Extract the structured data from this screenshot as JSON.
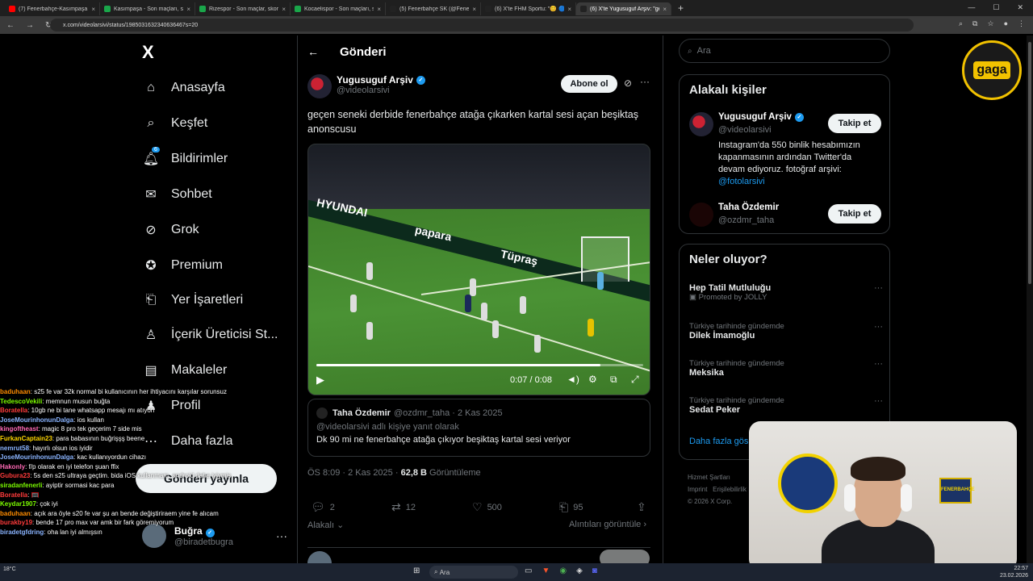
{
  "browser": {
    "tabs": [
      {
        "title": "(7) Fenerbahçe-Kasımpaşa Ma:",
        "color": "#ff0000"
      },
      {
        "title": "Kasımpaşa - Son maçları, skorla",
        "color": "#1aa64a"
      },
      {
        "title": "Rizespor - Son maçlar, skorlar",
        "color": "#1aa64a"
      },
      {
        "title": "Kocaelispor - Son maçları, skorl",
        "color": "#1aa64a"
      },
      {
        "title": "(5) Fenerbahçe SK (@Fenerbah",
        "color": "#222222"
      },
      {
        "title": "(6) X'te FHM Sportu: \"😊 🔵 Fe",
        "color": "#222222"
      },
      {
        "title": "(6) X'te Yugusuguf Arşiv: \"geçe",
        "color": "#222222"
      }
    ],
    "url": "x.com/videolarsivi/status/1985031632340636467s=20"
  },
  "nav": {
    "logo": "X",
    "items": [
      {
        "label": "Anasayfa",
        "icon": "home-icon"
      },
      {
        "label": "Keşfet",
        "icon": "search-icon"
      },
      {
        "label": "Bildirimler",
        "icon": "bell-icon",
        "badge": "6"
      },
      {
        "label": "Sohbet",
        "icon": "mail-icon"
      },
      {
        "label": "Grok",
        "icon": "grok-icon"
      },
      {
        "label": "Premium",
        "icon": "premium-icon"
      },
      {
        "label": "Yer İşaretleri",
        "icon": "bookmark-icon"
      },
      {
        "label": "İçerik Üreticisi St...",
        "icon": "creator-icon"
      },
      {
        "label": "Makaleler",
        "icon": "articles-icon"
      },
      {
        "label": "Profil",
        "icon": "profile-icon"
      },
      {
        "label": "Daha fazla",
        "icon": "more-icon"
      }
    ],
    "post_button": "Gönderi yayınla",
    "profile": {
      "name": "Buğra",
      "handle": "@biradetbugra"
    }
  },
  "chat": [
    {
      "user": "baduhaan",
      "color": "#ff8c00",
      "msg": ": s25 fe var 32k normal bi kullanıcının her ihtiyacını karşılar sorunsuz"
    },
    {
      "user": "TedescoVekili",
      "color": "#7cfc00",
      "msg": ": memnun musun buğta"
    },
    {
      "user": "Boratella",
      "color": "#ff3b3b",
      "msg": ": 10gb ne bi tane whatsapp mesajı mı atıyon"
    },
    {
      "user": "JoseMourinhonunDalga",
      "color": "#8ab4ff",
      "msg": ": ios kullan"
    },
    {
      "user": "kingoftheast",
      "color": "#ff69b4",
      "msg": ": magic 8 pro tek geçerim 7 side mis"
    },
    {
      "user": "FurkanCaptain23",
      "color": "#ffd700",
      "msg": ": para babasının buğrişşş beene"
    },
    {
      "user": "nemrut58",
      "color": "#8ab4ff",
      "msg": ": hayırlı olsun ios iyidir"
    },
    {
      "user": "JoseMourinhonunDalga",
      "color": "#8ab4ff",
      "msg": ": kac kullanıyordun cihazı"
    },
    {
      "user": "Hakonly",
      "color": "#ff69b4",
      "msg": ": f/p olarak en iyi telefon şuan ffix"
    },
    {
      "user": "Gubura23",
      "color": "#ff3b3b",
      "msg": ": 5s den s25 ultraya geçtim. bida iOS kullanmam. android daha iyiymiş"
    },
    {
      "user": "siradanfenerli",
      "color": "#7cfc00",
      "msg": ": ayiptir sormasi kac para"
    },
    {
      "user": "Boratella",
      "color": "#ff3b3b",
      "msg": ": 🥅"
    },
    {
      "user": "Keydar1907",
      "color": "#7cfc00",
      "msg": ": çok iyi"
    },
    {
      "user": "baduhaan",
      "color": "#ff8c00",
      "msg": ": açık ara öyle s20 fe var şu an bende değiştiriraem yine fe alıcam"
    },
    {
      "user": "burakby19",
      "color": "#ff3b3b",
      "msg": ": bende 17 pro max var amk bir fark göremiyorum"
    },
    {
      "user": "biradetgfdring",
      "color": "#8ab4ff",
      "msg": ": oha lan iyi almışsın"
    }
  ],
  "main": {
    "header": "Gönderi",
    "author": {
      "name": "Yugusuguf Arşiv",
      "handle": "@videolarsivi"
    },
    "subscribe": "Abone ol",
    "text": "geçen seneki derbide fenerbahçe atağa çıkarken kartal sesi açan beşiktaş anonscusu",
    "video": {
      "time": "0:07 / 0:08",
      "progress": 0.87,
      "ads": [
        "HYUNDAI",
        "papara",
        "Tüpraş"
      ]
    },
    "quote": {
      "name": "Taha Özdemir",
      "handle": "@ozdmr_taha",
      "date": "· 2 Kas 2025",
      "reply_to": "@videolarsivi adlı kişiye yanıt olarak",
      "text": "Dk 90 mi ne fenerbahçe atağa çıkıyor beşiktaş kartal sesi veriyor"
    },
    "meta": {
      "time": "ÖS 8:09 · 2 Kas 2025 · ",
      "views": "62,8 B",
      "views_label": " Görüntüleme"
    },
    "actions": {
      "replies": "2",
      "reposts": "12",
      "likes": "500",
      "bookmarks": "95"
    },
    "related_label": "Alakalı",
    "quotes_link": "Alıntıları görüntüle"
  },
  "sidebar": {
    "search_placeholder": "Ara",
    "related_title": "Alakalı kişiler",
    "people": [
      {
        "name": "Yugusuguf Arşiv",
        "handle": "@videolarsivi",
        "bio": "Instagram'da 550 binlik hesabımızın kapanmasının ardından Twitter'da devam ediyoruz. fotoğraf arşivi:",
        "bio_link": "@fotolarsivi",
        "button": "Takip et"
      },
      {
        "name": "Taha Özdemir",
        "handle": "@ozdmr_taha",
        "button": "Takip et"
      }
    ],
    "trends_title": "Neler oluyor?",
    "trends": [
      {
        "name": "Hep Tatil Mutluluğu",
        "promo": "Promoted by JOLLY"
      },
      {
        "category": "Türkiye tarihinde gündemde",
        "name": "Dilek İmamoğlu"
      },
      {
        "category": "Türkiye tarihinde gündemde",
        "name": "Meksika"
      },
      {
        "category": "Türkiye tarihinde gündemde",
        "name": "Sedat Peker"
      }
    ],
    "show_more": "Daha fazla gös",
    "footer": [
      "Hizmet Şartları",
      "Imprint",
      "Erişilebilirlik",
      "© 2026 X Corp."
    ]
  },
  "overlay": {
    "gaga_logo": "gaga",
    "jersey_box": "FENERBAHÇE"
  },
  "taskbar": {
    "search": "Ara",
    "weather": "18°C",
    "time": "22:57",
    "date": "23.02.2026"
  }
}
